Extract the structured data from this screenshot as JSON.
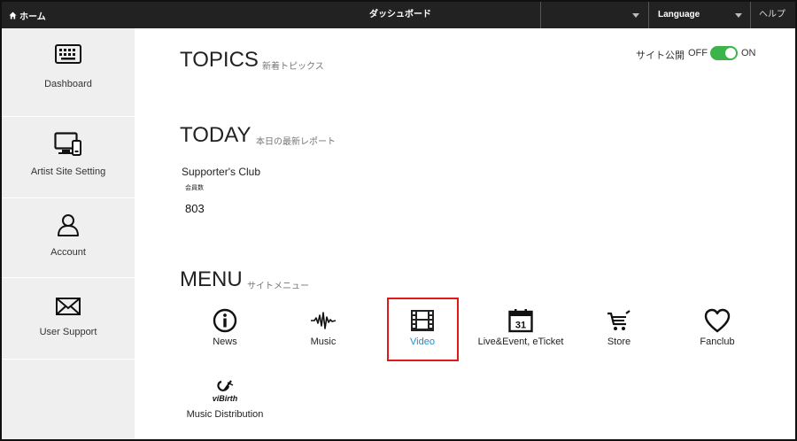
{
  "topbar": {
    "home_label": "ホーム",
    "title": "ダッシュボード",
    "language_label": "Language",
    "help_label": "ヘルプ"
  },
  "sidebar": {
    "items": [
      {
        "label": "Dashboard",
        "icon": "keyboard-icon"
      },
      {
        "label": "Artist Site Setting",
        "icon": "devices-icon"
      },
      {
        "label": "Account",
        "icon": "user-icon"
      },
      {
        "label": "User Support",
        "icon": "envelope-icon"
      }
    ]
  },
  "topics": {
    "title": "TOPICS",
    "subtitle": "新着トピックス"
  },
  "site_publish": {
    "label": "サイト公開",
    "off_label": "OFF",
    "on_label": "ON",
    "state": "on",
    "color": "#3cb44a"
  },
  "today": {
    "title": "TODAY",
    "subtitle": "本日の最新レポート",
    "club_name": "Supporter's Club",
    "club_sub": "会員数",
    "club_count": "803"
  },
  "menu": {
    "title": "MENU",
    "subtitle": "サイトメニュー",
    "items": [
      {
        "label": "News",
        "icon": "info-icon"
      },
      {
        "label": "Music",
        "icon": "waveform-icon"
      },
      {
        "label": "Video",
        "icon": "film-icon",
        "selected": true,
        "color": "#1a8fd6"
      },
      {
        "label": "Live&Event, eTicket",
        "icon": "calendar-icon",
        "icon_text": "31"
      },
      {
        "label": "Store",
        "icon": "cart-icon"
      },
      {
        "label": "Fanclub",
        "icon": "heart-icon"
      }
    ],
    "distribution": {
      "label": "Music Distribution",
      "icon": "vibirth-logo-icon",
      "logo_text": "viBirth"
    }
  },
  "highlight_color": "#e0191b"
}
